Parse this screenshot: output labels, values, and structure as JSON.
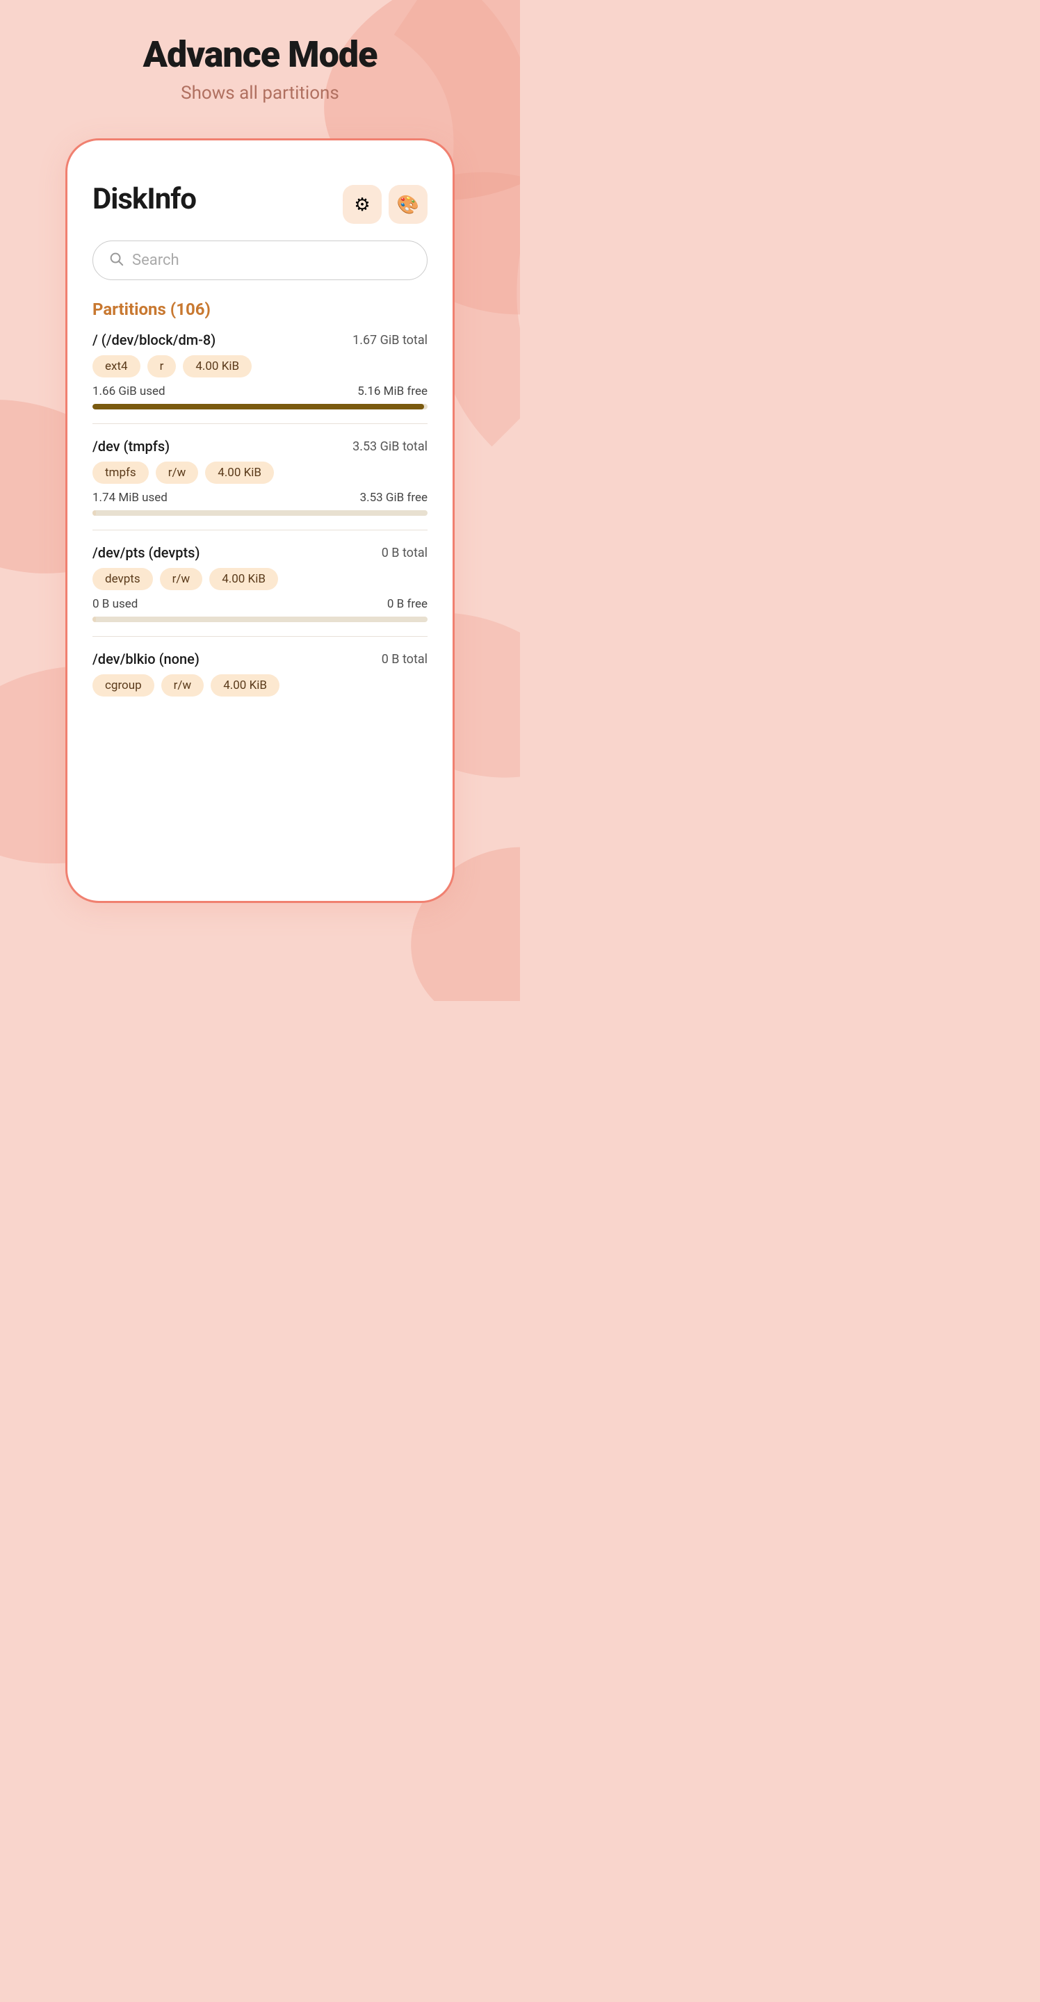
{
  "page": {
    "title": "Advance Mode",
    "subtitle": "Shows all partitions"
  },
  "app": {
    "title": "DiskInfo",
    "settings_btn": "⚙",
    "palette_btn": "🎨",
    "search_placeholder": "Search"
  },
  "section": {
    "label": "Partitions (106)"
  },
  "partitions": [
    {
      "name": "/ (/dev/block/dm-8)",
      "total": "1.67 GiB total",
      "tags": [
        "ext4",
        "r",
        "4.00 KiB"
      ],
      "used_label": "1.66 GiB used",
      "free_label": "5.16 MiB free",
      "fill_pct": 99,
      "fill_class": "fill-high"
    },
    {
      "name": "/dev (tmpfs)",
      "total": "3.53 GiB total",
      "tags": [
        "tmpfs",
        "r/w",
        "4.00 KiB"
      ],
      "used_label": "1.74 MiB used",
      "free_label": "3.53 GiB free",
      "fill_pct": 1,
      "fill_class": "fill-low"
    },
    {
      "name": "/dev/pts (devpts)",
      "total": "0 B total",
      "tags": [
        "devpts",
        "r/w",
        "4.00 KiB"
      ],
      "used_label": "0 B used",
      "free_label": "0 B free",
      "fill_pct": 0,
      "fill_class": "fill-zero"
    },
    {
      "name": "/dev/blkio (none)",
      "total": "0 B total",
      "tags": [
        "cgroup",
        "r/w",
        "4.00 KiB"
      ],
      "used_label": "",
      "free_label": "",
      "fill_pct": 0,
      "fill_class": "fill-zero",
      "no_usage": true
    }
  ]
}
